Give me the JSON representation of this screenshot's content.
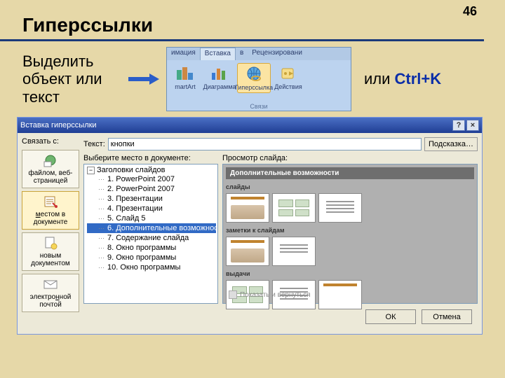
{
  "page_number": "46",
  "slide_title": "Гиперссылки",
  "instruction": "Выделить объект или текст",
  "shortcut_prefix": "или ",
  "shortcut_key": "Ctrl+K",
  "ribbon": {
    "tabs": [
      "имация",
      "Вставка",
      "в",
      "Рецензировани"
    ],
    "buttons": [
      {
        "label": "martArt"
      },
      {
        "label": "Диаграмма"
      },
      {
        "label": "Гиперссылка"
      },
      {
        "label": "Действия"
      }
    ],
    "group_label": "Связи"
  },
  "dialog": {
    "title": "Вставка гиперссылки",
    "help": "?",
    "close": "×",
    "link_label": "Связать с:",
    "link_targets": [
      "файлом, веб-страницей",
      "местом в документе",
      "новым документом",
      "электронной почтой"
    ],
    "text_label": "Текст:",
    "text_value": "кнопки",
    "hint_btn": "Подсказка…",
    "tree_label": "Выберите место в документе:",
    "tree_root": "Заголовки слайдов",
    "tree_items": [
      "1. PowerPoint 2007",
      "2. PowerPoint 2007",
      "3. Презентации",
      "4. Презентации",
      "5. Слайд 5",
      "6. Дополнительные возможнос",
      "7. Содержание слайда",
      "8. Окно программы",
      "9. Окно программы",
      "10. Окно программы"
    ],
    "preview_label": "Просмотр слайда:",
    "preview_title": "Дополнительные возможности",
    "preview_sec1": "слайды",
    "preview_sec2": "заметки к слайдам",
    "preview_sec3": "выдачи",
    "show_return": "Показать и вернуться",
    "ok": "ОК",
    "cancel": "Отмена"
  }
}
